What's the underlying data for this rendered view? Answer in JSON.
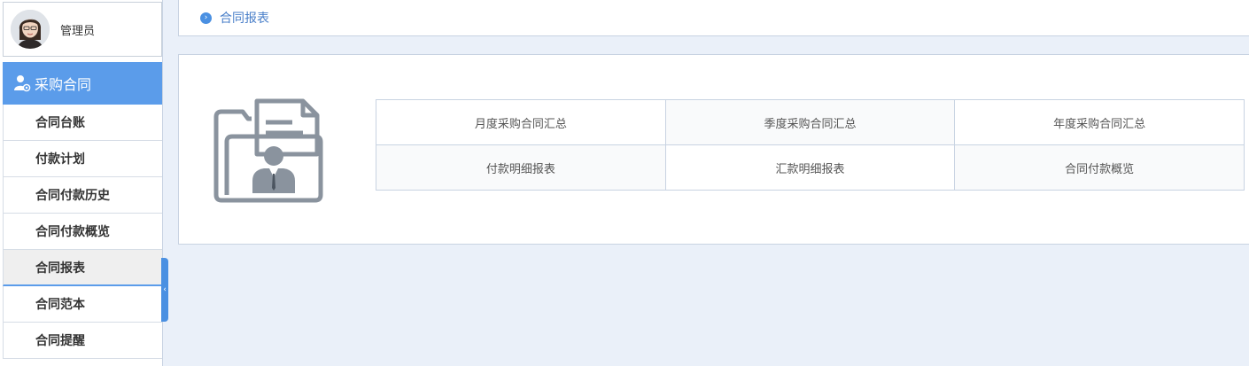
{
  "user": {
    "name": "管理员"
  },
  "menu": {
    "header": "采购合同",
    "items": [
      {
        "label": "合同台账"
      },
      {
        "label": "付款计划"
      },
      {
        "label": "合同付款历史"
      },
      {
        "label": "合同付款概览"
      },
      {
        "label": "合同报表",
        "active": true
      },
      {
        "label": "合同范本"
      },
      {
        "label": "合同提醒"
      }
    ]
  },
  "breadcrumb": {
    "current": "合同报表"
  },
  "reports": {
    "rows": [
      [
        "月度采购合同汇总",
        "季度采购合同汇总",
        "年度采购合同汇总"
      ],
      [
        "付款明细报表",
        "汇款明细报表",
        "合同付款概览"
      ]
    ]
  },
  "colors": {
    "accent": "#5b9cea",
    "handle": "#4a90e2",
    "background": "#eaf0f9",
    "icon_gray": "#8a939e"
  }
}
